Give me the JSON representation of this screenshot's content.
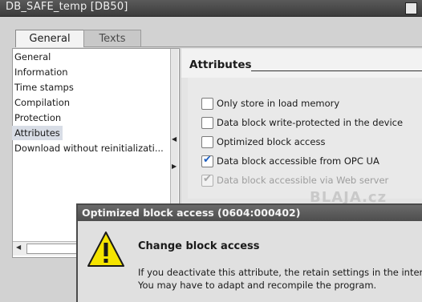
{
  "window": {
    "title": "DB_SAFE_temp [DB50]"
  },
  "tabs": [
    {
      "label": "General",
      "active": true
    },
    {
      "label": "Texts",
      "active": false
    }
  ],
  "nav": {
    "items": [
      {
        "label": "General",
        "selected": false
      },
      {
        "label": "Information",
        "selected": false
      },
      {
        "label": "Time stamps",
        "selected": false
      },
      {
        "label": "Compilation",
        "selected": false
      },
      {
        "label": "Protection",
        "selected": false
      },
      {
        "label": "Attributes",
        "selected": true
      },
      {
        "label": "Download without reinitializati...",
        "selected": false
      }
    ]
  },
  "attributes": {
    "heading": "Attributes",
    "options": [
      {
        "label": "Only store in load memory",
        "checked": false,
        "enabled": true
      },
      {
        "label": "Data block write-protected in the device",
        "checked": false,
        "enabled": true
      },
      {
        "label": "Optimized block access",
        "checked": false,
        "enabled": true
      },
      {
        "label": "Data block accessible from OPC UA",
        "checked": true,
        "enabled": true
      },
      {
        "label": "Data block accessible via Web server",
        "checked": true,
        "enabled": false
      }
    ]
  },
  "watermark": "BLAJA.cz",
  "dialog": {
    "title": "Optimized block access (0604:000402)",
    "heading": "Change block access",
    "message_line1": "If you deactivate this attribute, the retain settings in the interface",
    "message_line2": "You may have to adapt and recompile the program.",
    "icon": "warning-icon"
  },
  "colors": {
    "titlebar": "#4a4a4a",
    "selection": "#d8dde6",
    "checkmark": "#1f5fbf",
    "warning": "#f5e400"
  }
}
